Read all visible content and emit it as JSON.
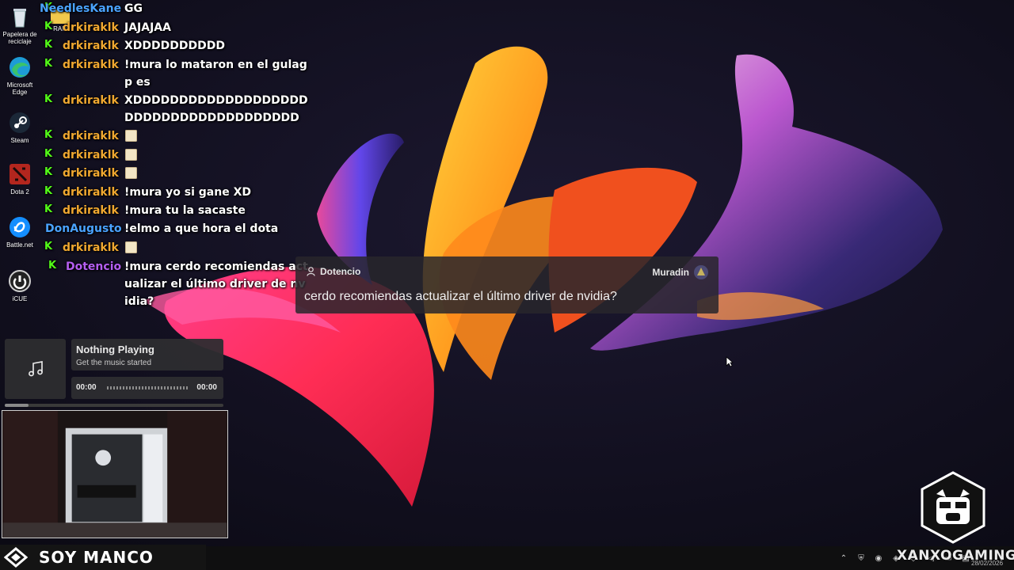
{
  "desktop": {
    "icons": [
      {
        "label": "Papelera de reciclaje",
        "icon": "recycle-bin-icon"
      },
      {
        "label": "Microsoft Edge",
        "icon": "edge-icon"
      },
      {
        "label": "Steam",
        "icon": "steam-icon"
      },
      {
        "label": "Dota 2",
        "icon": "dota2-icon"
      },
      {
        "label": "Battle.net",
        "icon": "battlenet-icon"
      },
      {
        "label": "iCUE",
        "icon": "icue-icon"
      }
    ],
    "ram_label": "RAM"
  },
  "chat": {
    "badge_glyph": "K",
    "messages": [
      {
        "user": "NeedlesKane",
        "color": "#4aa3ff",
        "text": "GG"
      },
      {
        "user": "drkiraklk",
        "color": "#f0a830",
        "text": "JAJAJAA"
      },
      {
        "user": "drkiraklk",
        "color": "#f0a830",
        "text": "XDDDDDDDDDD"
      },
      {
        "user": "drkiraklk",
        "color": "#f0a830",
        "text": "!mura lo mataron en el gulagp es"
      },
      {
        "user": "drkiraklk",
        "color": "#f0a830",
        "text": "XDDDDDDDDDDDDDDDDDDDDDDDDDDDDDDDDDDDDDDD"
      },
      {
        "user": "drkiraklk",
        "color": "#f0a830",
        "text": "",
        "emote": true
      },
      {
        "user": "drkiraklk",
        "color": "#f0a830",
        "text": "",
        "emote": true
      },
      {
        "user": "drkiraklk",
        "color": "#f0a830",
        "text": "",
        "emote": true
      },
      {
        "user": "drkiraklk",
        "color": "#f0a830",
        "text": "!mura yo si gane XD"
      },
      {
        "user": "drkiraklk",
        "color": "#f0a830",
        "text": "!mura tu la sacaste"
      },
      {
        "user": "DonAugusto",
        "color": "#4aa3ff",
        "text": "!elmo a que hora el dota"
      },
      {
        "user": "drkiraklk",
        "color": "#f0a830",
        "text": "",
        "emote": true
      },
      {
        "user": "Dotencio",
        "color": "#b45ef0",
        "text": "!mura cerdo recomiendas actualizar el último driver de nvidia?"
      }
    ]
  },
  "alert": {
    "user": "Dotencio",
    "moderator": "Muradin",
    "message": "cerdo recomiendas actualizar el último driver de nvidia?"
  },
  "music": {
    "title": "Nothing Playing",
    "subtitle": "Get the music started",
    "time_current": "00:00",
    "time_total": "00:00",
    "progress": 0.11
  },
  "branding": {
    "title": "SOY MANCO",
    "watermark": "XANXOGAMING"
  },
  "taskbar": {
    "date": "28/02/2026"
  },
  "colors": {
    "kick_green": "#53fc18",
    "panel": "#2d2d30"
  }
}
